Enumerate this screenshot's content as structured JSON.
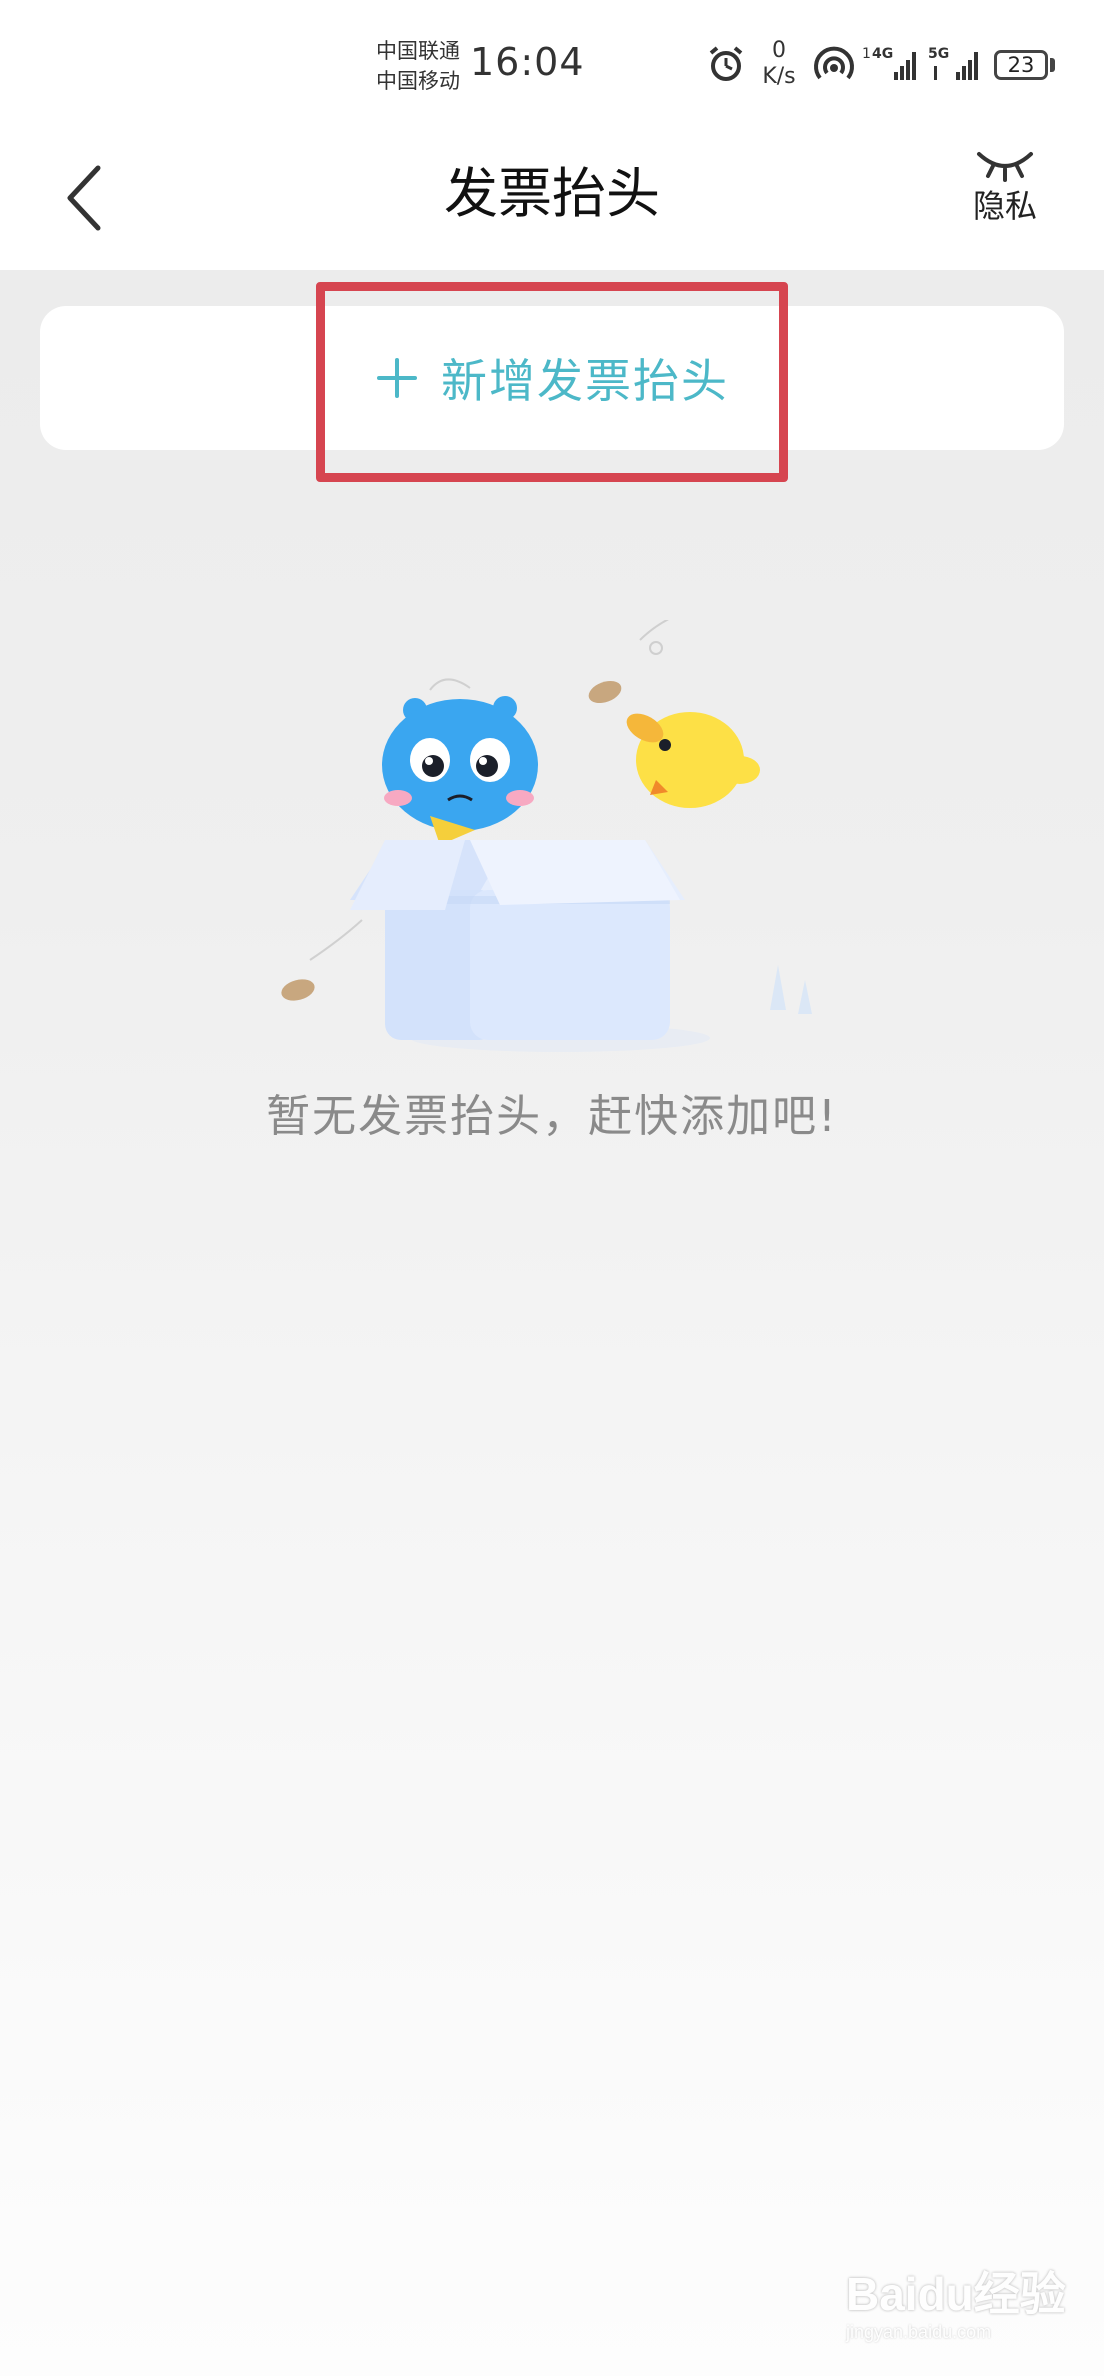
{
  "status_bar": {
    "carrier_1": "中国联通",
    "carrier_2": "中国移动",
    "time": "16:04",
    "net_speed_value": "0",
    "net_speed_unit": "K/s",
    "signal_1_label": "1",
    "signal_1_type": "4G",
    "signal_2_type": "5G",
    "battery_level": "23"
  },
  "header": {
    "title": "发票抬头",
    "privacy_label": "隐私",
    "back_icon": "chevron-left-icon",
    "privacy_icon": "closed-eye-icon"
  },
  "main": {
    "add_button": {
      "icon": "plus-icon",
      "label": "新增发票抬头"
    },
    "empty_state": {
      "message": "暂无发票抬头，赶快添加吧!"
    }
  },
  "watermark": {
    "main": "Baidu经验",
    "sub": "jingyan.baidu.com"
  },
  "colors": {
    "accent": "#4cb8c8",
    "highlight_border": "#d64550",
    "empty_text": "#8a8a8a"
  }
}
